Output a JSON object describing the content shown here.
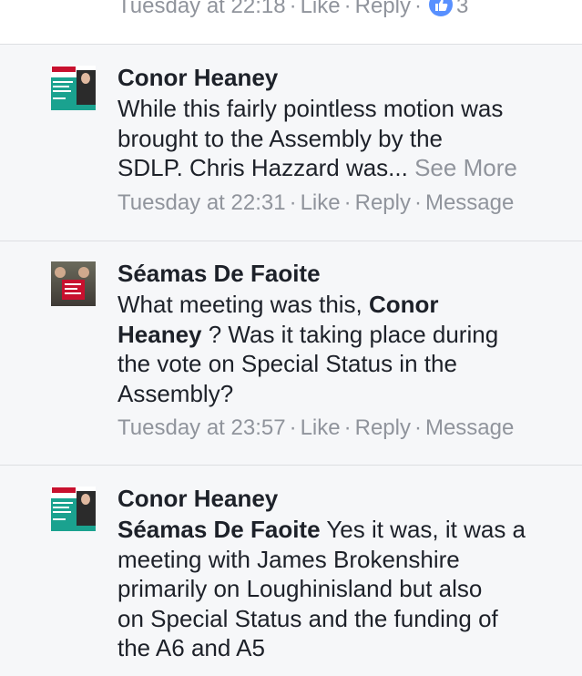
{
  "top_meta": {
    "time": "Tuesday at 22:18",
    "like": "Like",
    "reply": "Reply",
    "sep": "·",
    "reaction_count": "3"
  },
  "comments": [
    {
      "name": "Conor Heaney",
      "lines": [
        "While this fairly pointless motion was",
        "brought to the Assembly by the",
        "SDLP. Chris Hazzard was... "
      ],
      "see_more": "See More",
      "time": "Tuesday at 22:31",
      "like": "Like",
      "reply": "Reply",
      "message": "Message"
    },
    {
      "name": "Séamas De Faoite",
      "line1_text": "What meeting was this, ",
      "line1_mention": "Conor",
      "line2_mention": "Heaney",
      "line2_text": " ? Was it taking place during",
      "line3": "the vote on Special Status in the",
      "line4": "Assembly?",
      "time": "Tuesday at 23:57",
      "like": "Like",
      "reply": "Reply",
      "message": "Message"
    },
    {
      "name": "Conor Heaney",
      "line1_mention": "Séamas De Faoite",
      "line1_text": " Yes it was, it was a",
      "line2": "meeting with James Brokenshire",
      "line3": "primarily on Loughinisland but also",
      "line4": "on Special Status and the funding of",
      "line5": "the A6 and A5"
    }
  ],
  "colors": {
    "background": "#ffffff",
    "comment_background": "#f6f7f9",
    "text": "#1d2129",
    "meta": "#90949c",
    "like_badge": "#5890ff"
  },
  "icons": {
    "like_badge": "thumbs-up-icon"
  }
}
